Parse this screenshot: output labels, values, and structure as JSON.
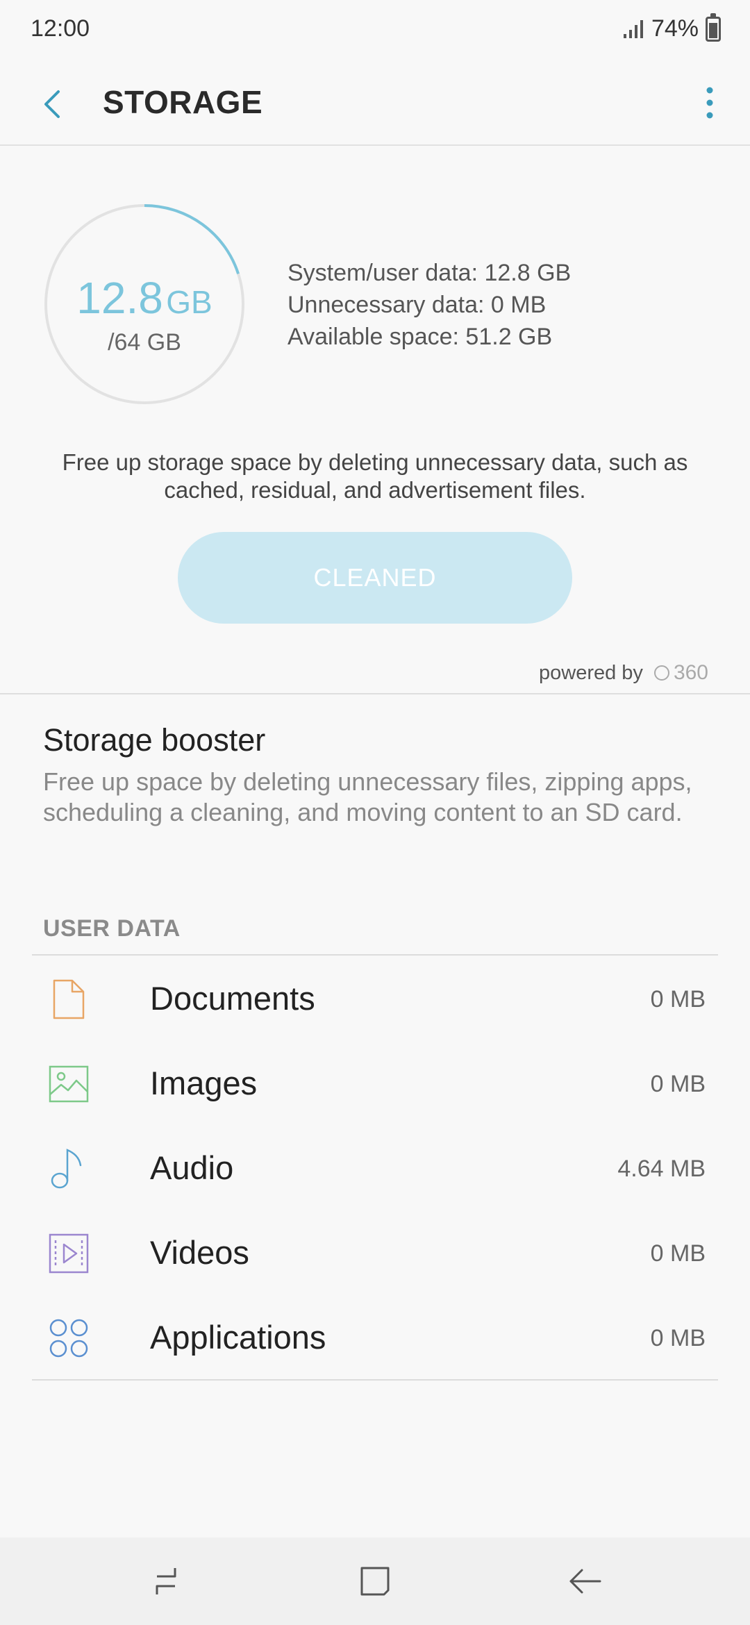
{
  "status_bar": {
    "time": "12:00",
    "battery": "74%"
  },
  "header": {
    "title": "STORAGE"
  },
  "gauge": {
    "used_value": "12.8",
    "used_unit": "GB",
    "total": "/64 GB",
    "used_fraction": 0.2
  },
  "details": {
    "system_user": "System/user data: 12.8 GB",
    "unnecessary": "Unnecessary data: 0 MB",
    "available": "Available space: 51.2 GB"
  },
  "description": "Free up storage space by deleting unnecessary data, such as cached, residual, and advertisement files.",
  "clean_button": "CLEANED",
  "powered_by": {
    "label": "powered by",
    "brand": "360"
  },
  "booster": {
    "title": "Storage booster",
    "description": "Free up space by deleting unnecessary files, zipping apps, scheduling a cleaning, and moving content to an SD card."
  },
  "user_data": {
    "header": "USER DATA",
    "items": [
      {
        "label": "Documents",
        "size": "0 MB",
        "icon": "document-icon",
        "color": "#e8a565"
      },
      {
        "label": "Images",
        "size": "0 MB",
        "icon": "image-icon",
        "color": "#7dc989"
      },
      {
        "label": "Audio",
        "size": "4.64 MB",
        "icon": "music-note-icon",
        "color": "#5aa4d0"
      },
      {
        "label": "Videos",
        "size": "0 MB",
        "icon": "video-icon",
        "color": "#9b86cf"
      },
      {
        "label": "Applications",
        "size": "0 MB",
        "icon": "apps-icon",
        "color": "#5a8fd0"
      }
    ]
  },
  "colors": {
    "accent": "#7cc5dc",
    "button_bg": "#cbe8f2"
  }
}
